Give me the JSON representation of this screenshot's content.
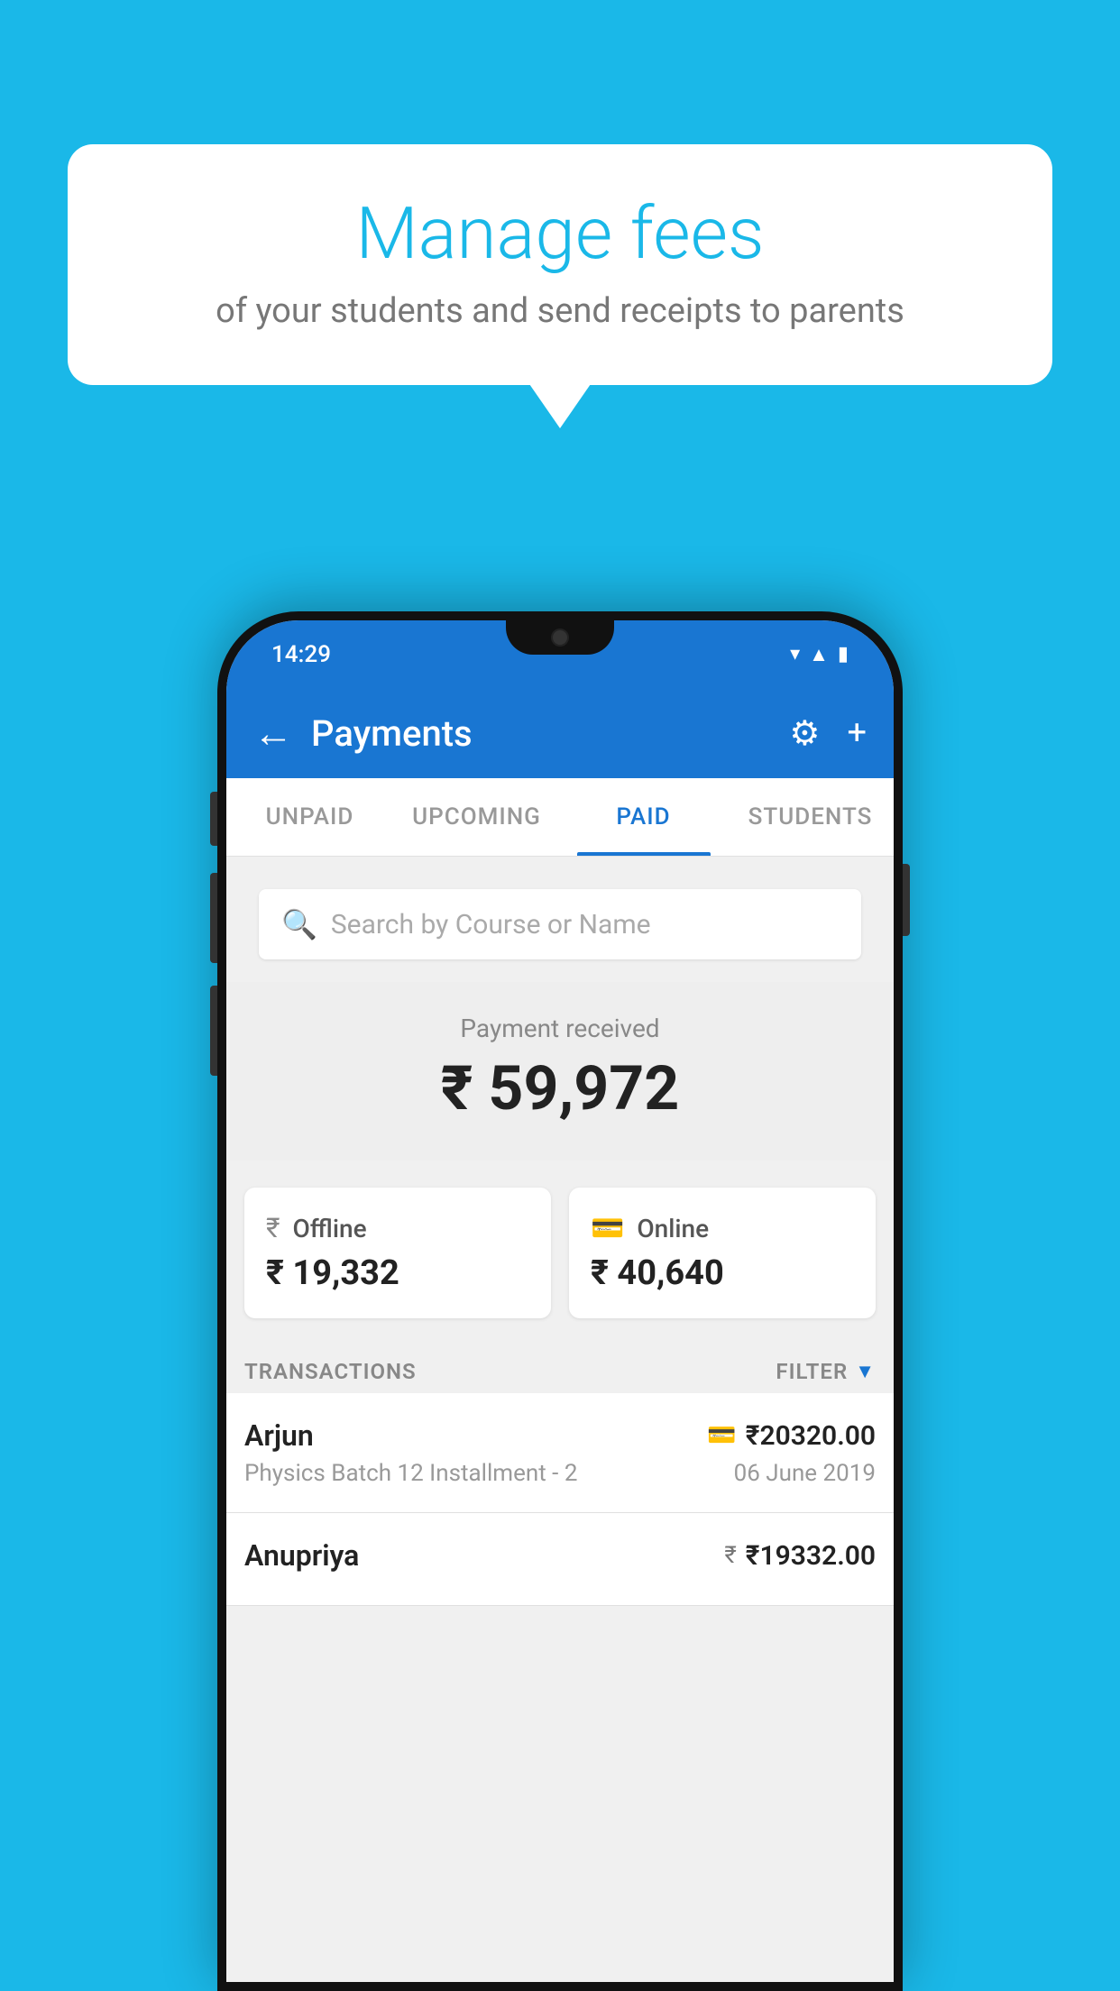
{
  "background_color": "#1ab8e8",
  "speech_bubble": {
    "title": "Manage fees",
    "subtitle": "of your students and send receipts to parents"
  },
  "phone": {
    "status_bar": {
      "time": "14:29"
    },
    "app_bar": {
      "title": "Payments",
      "back_label": "←",
      "settings_label": "⚙",
      "add_label": "+"
    },
    "tabs": [
      {
        "label": "UNPAID",
        "active": false
      },
      {
        "label": "UPCOMING",
        "active": false
      },
      {
        "label": "PAID",
        "active": true
      },
      {
        "label": "STUDENTS",
        "active": false
      }
    ],
    "search": {
      "placeholder": "Search by Course or Name"
    },
    "payment_summary": {
      "label": "Payment received",
      "amount": "₹ 59,972"
    },
    "payment_cards": [
      {
        "type": "Offline",
        "icon": "rupee-icon",
        "amount": "₹ 19,332"
      },
      {
        "type": "Online",
        "icon": "card-icon",
        "amount": "₹ 40,640"
      }
    ],
    "transactions_header": {
      "label": "TRANSACTIONS",
      "filter_label": "FILTER"
    },
    "transactions": [
      {
        "name": "Arjun",
        "description": "Physics Batch 12 Installment - 2",
        "amount": "₹20320.00",
        "method": "card",
        "date": "06 June 2019"
      },
      {
        "name": "Anupriya",
        "description": "",
        "amount": "₹19332.00",
        "method": "rupee",
        "date": ""
      }
    ]
  }
}
